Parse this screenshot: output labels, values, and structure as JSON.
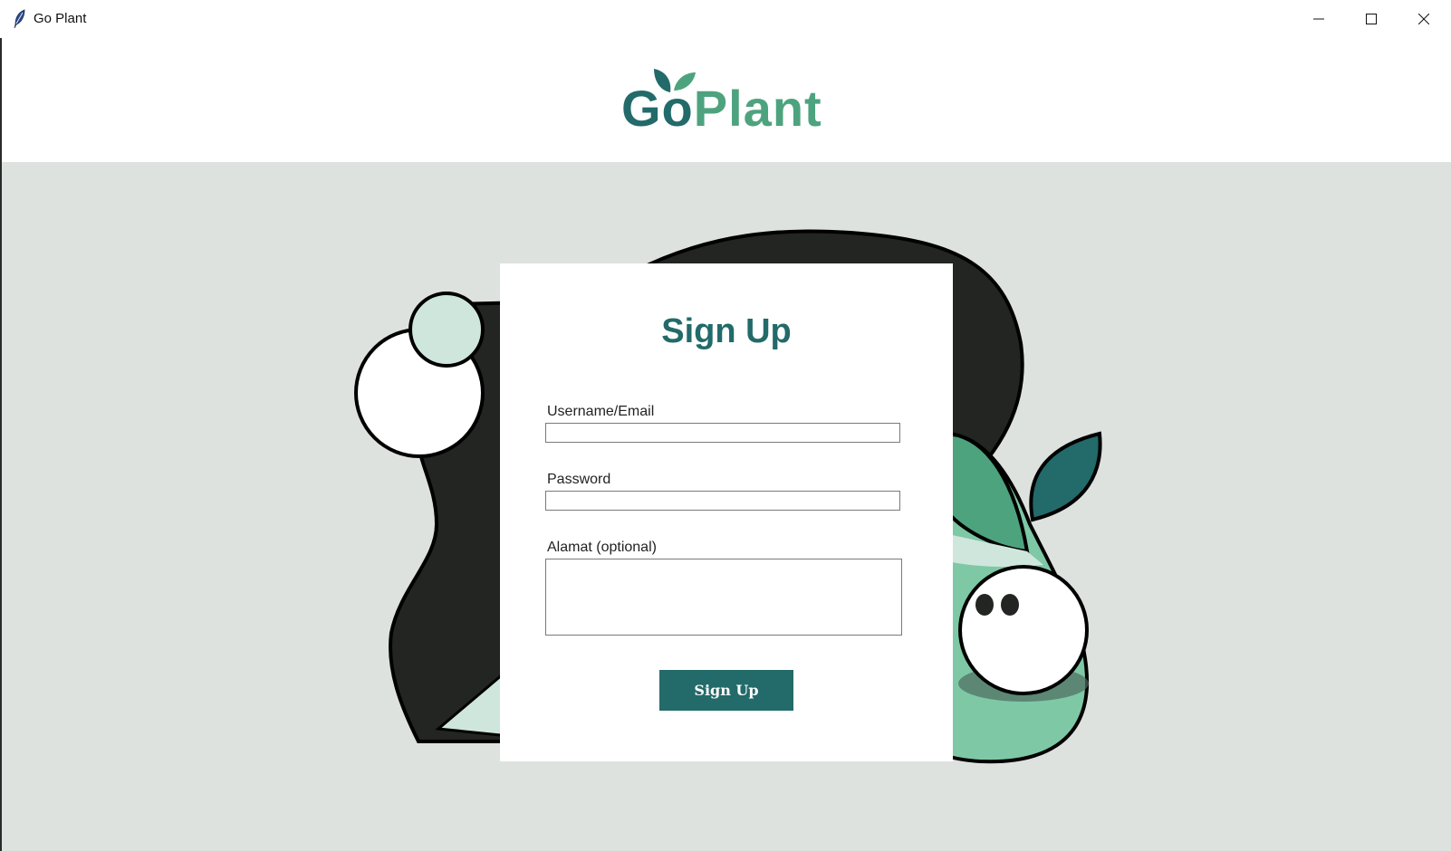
{
  "window": {
    "title": "Go Plant"
  },
  "logo": {
    "part1": "Go",
    "part2": "Plant"
  },
  "form": {
    "title": "Sign Up",
    "username_label": "Username/Email",
    "username_value": "",
    "password_label": "Password",
    "password_value": "",
    "address_label": "Alamat (optional)",
    "address_value": "",
    "submit_label": "Sign Up"
  },
  "colors": {
    "brand_dark": "#236a6a",
    "brand_light": "#4ea37f",
    "background": "#dde2df",
    "blob_dark": "#222522",
    "mint": "#7ec8a6",
    "pale_mint": "#cfe6dc"
  },
  "icons": {
    "app": "feather-icon",
    "minimize": "minimize-icon",
    "maximize": "maximize-icon",
    "close": "close-icon"
  }
}
